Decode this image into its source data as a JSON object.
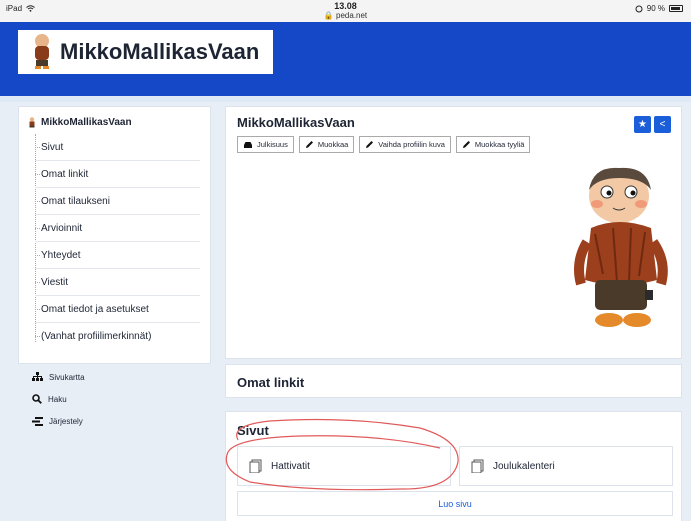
{
  "status_bar": {
    "device": "iPad",
    "wifi_icon": "wifi-icon",
    "time": "13.08",
    "url": "peda.net",
    "battery": "90 %"
  },
  "header": {
    "site_title": "MikkoMallikasVaan"
  },
  "sidebar": {
    "title": "MikkoMallikasVaan",
    "items": [
      {
        "label": "Sivut"
      },
      {
        "label": "Omat linkit"
      },
      {
        "label": "Omat tilaukseni"
      },
      {
        "label": "Arvioinnit"
      },
      {
        "label": "Yhteydet"
      },
      {
        "label": "Viestit"
      },
      {
        "label": "Omat tiedot ja asetukset"
      },
      {
        "label": "(Vanhat profiilimerkinnät)"
      }
    ]
  },
  "tools": [
    {
      "label": "Sivukartta",
      "icon": "sitemap-icon"
    },
    {
      "label": "Haku",
      "icon": "search-icon"
    },
    {
      "label": "Järjestely",
      "icon": "sort-icon"
    }
  ],
  "profile": {
    "title": "MikkoMallikasVaan",
    "actions": [
      {
        "label": "Julkisuus",
        "icon": "car-icon"
      },
      {
        "label": "Muokkaa",
        "icon": "pencil-icon"
      },
      {
        "label": "Vaihda profiilin kuva",
        "icon": "pencil-icon"
      },
      {
        "label": "Muokkaa tyyliä",
        "icon": "pencil-icon"
      }
    ]
  },
  "links_section": {
    "title": "Omat linkit"
  },
  "pages_section": {
    "title": "Sivut",
    "pages": [
      {
        "label": "Hattivatit"
      },
      {
        "label": "Joulukalenteri"
      }
    ],
    "create_label": "Luo sivu"
  },
  "colors": {
    "banner": "#1448c6",
    "accent": "#1a5ed9",
    "annotation": "#e05a5a"
  }
}
